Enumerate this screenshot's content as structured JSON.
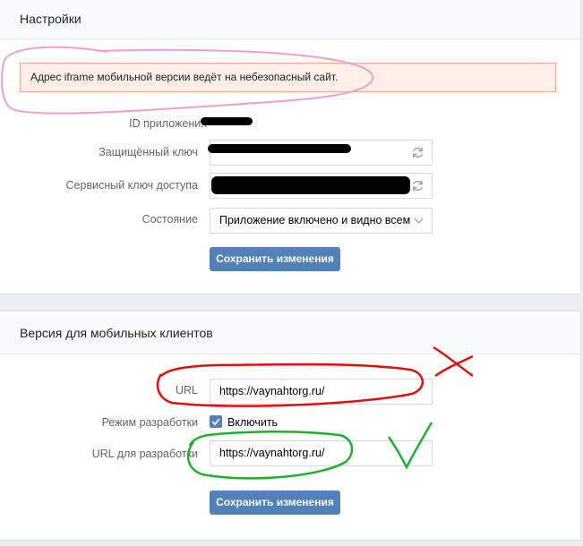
{
  "settings": {
    "title": "Настройки",
    "alert": "Адрес iframe мобильной версии ведёт на небезопасный сайт.",
    "app_id_label": "ID приложения",
    "secret_key_label": "Защищённый ключ",
    "service_key_label": "Сервисный ключ доступа",
    "state_label": "Состояние",
    "state_value": "Приложение включено и видно всем",
    "save_label": "Сохранить изменения"
  },
  "mobile": {
    "title": "Версия для мобильных клиентов",
    "url_label": "URL",
    "url_value": "https://vaynahtorg.ru/",
    "dev_mode_label": "Режим разработки",
    "dev_mode_checkbox_label": "Включить",
    "dev_mode_enabled": true,
    "dev_url_label": "URL для разработки",
    "dev_url_value": "https://vaynahtorg.ru/",
    "save_label": "Сохранить изменения"
  },
  "colors": {
    "button": "#5181b8",
    "alert_bg": "#ffefe9",
    "alert_border": "#f2ab99",
    "annotation_pink": "#f0a0c8",
    "annotation_red": "#e01010",
    "annotation_green": "#20b030"
  },
  "icons": {
    "refresh": "refresh-icon",
    "chevron": "chevron-down-icon",
    "check": "check-icon"
  }
}
